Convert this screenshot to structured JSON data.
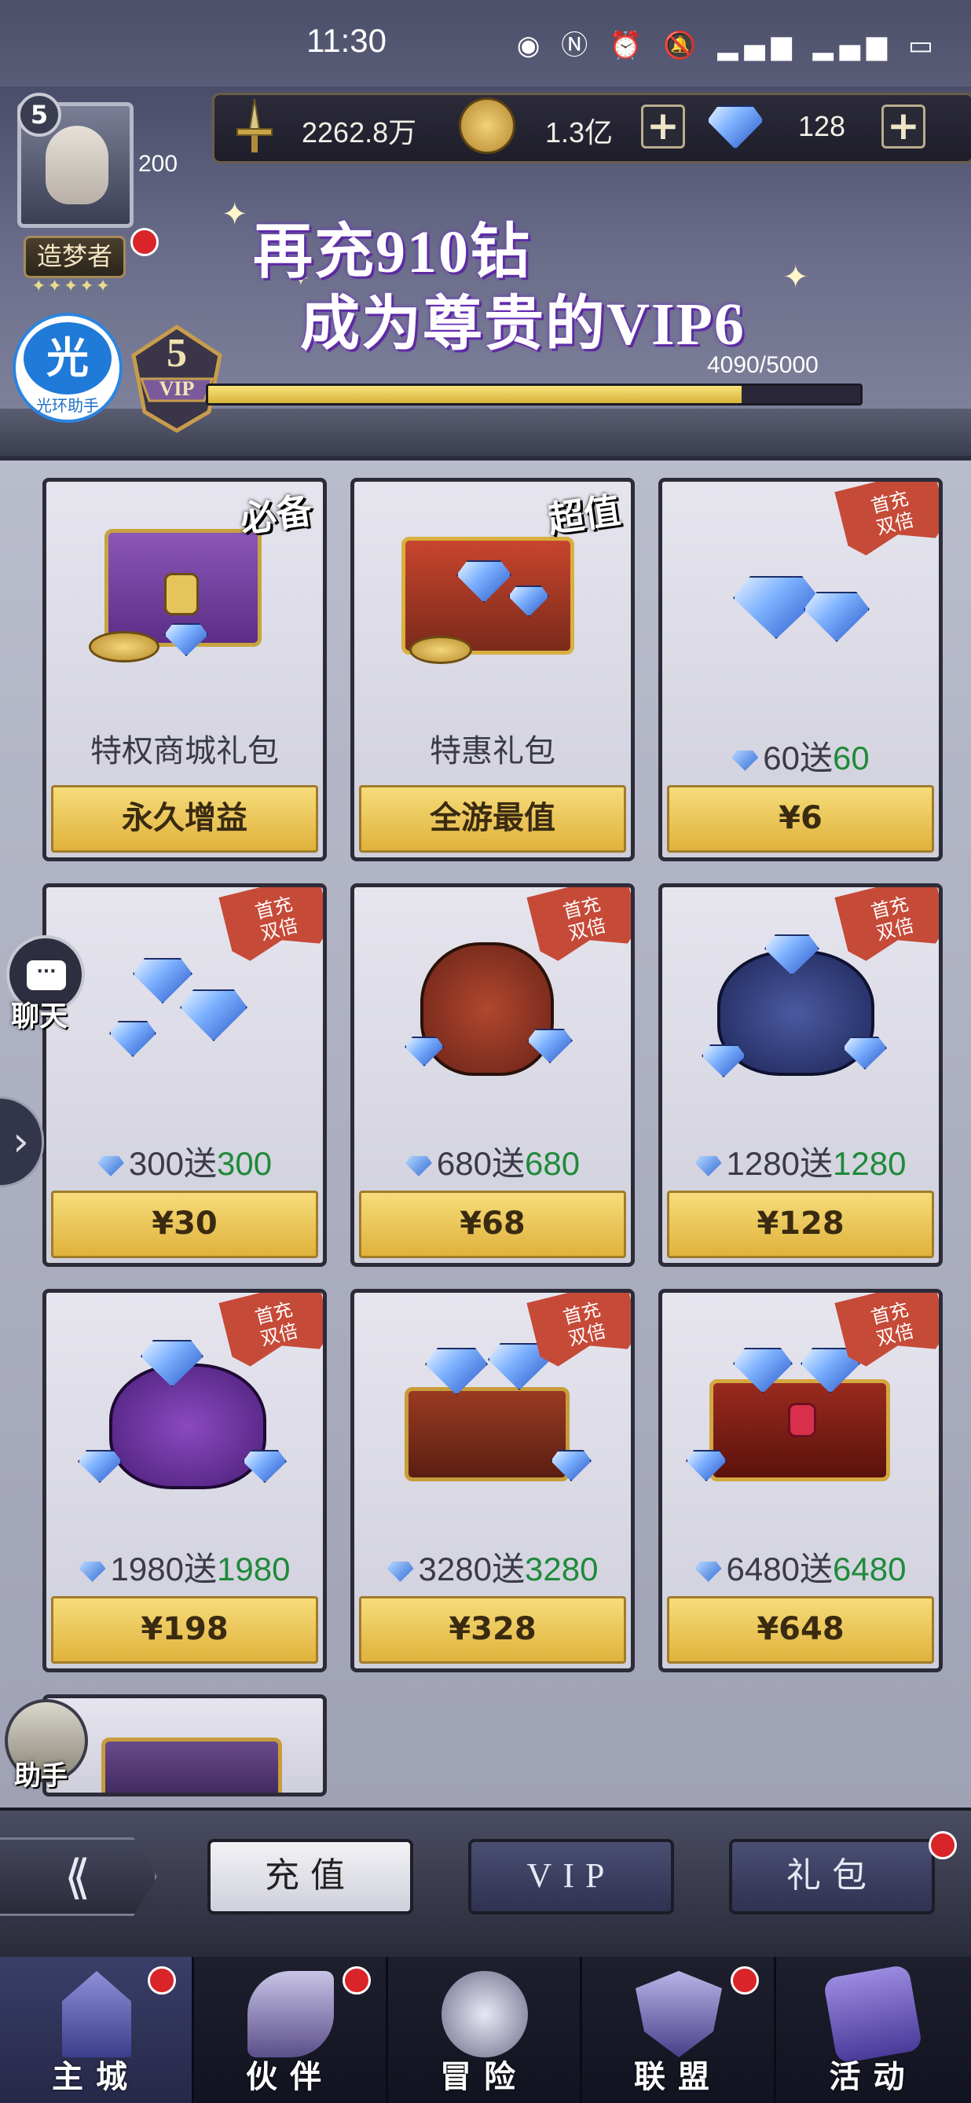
{
  "status_bar": {
    "time": "11:30",
    "icons": [
      "eye-icon",
      "nfc-icon",
      "alarm-icon",
      "mute-icon",
      "signal-4g-icon",
      "signal-4g-icon",
      "battery-icon"
    ],
    "icons_text": "◉ Ⓝ ⏰ 🔕 ▂▄▆ ▂▄▆ ▭"
  },
  "player": {
    "level": "5",
    "power_small": "200",
    "title": "造梦者",
    "stars": "✦✦✦✦✦"
  },
  "resources": {
    "power": "2262.8万",
    "gold": "1.3亿",
    "diamonds": "128"
  },
  "helper": {
    "glyph": "光",
    "label": "光环助手"
  },
  "vip": {
    "level": "5",
    "label": "VIP",
    "progress_text": "4090/5000",
    "progress_fraction": 0.818
  },
  "banner": {
    "line1": "再充910钻",
    "line2": "成为尊贵的VIP6"
  },
  "ribbon": {
    "line1": "首充",
    "line2": "双倍"
  },
  "cards": [
    {
      "name": "特权商城礼包",
      "button": "永久增益",
      "tag": "必备"
    },
    {
      "name": "特惠礼包",
      "button": "全游最值",
      "tag": "超值"
    },
    {
      "base": "60",
      "sep": "送",
      "bonus": "60",
      "button": "¥6"
    },
    {
      "base": "300",
      "sep": "送",
      "bonus": "300",
      "button": "¥30"
    },
    {
      "base": "680",
      "sep": "送",
      "bonus": "680",
      "button": "¥68"
    },
    {
      "base": "1280",
      "sep": "送",
      "bonus": "1280",
      "button": "¥128"
    },
    {
      "base": "1980",
      "sep": "送",
      "bonus": "1980",
      "button": "¥198"
    },
    {
      "base": "3280",
      "sep": "送",
      "bonus": "3280",
      "button": "¥328"
    },
    {
      "base": "6480",
      "sep": "送",
      "bonus": "6480",
      "button": "¥648"
    }
  ],
  "side": {
    "chat": "聊天",
    "assist": "助手",
    "chat_icon": "···",
    "arrow": "›"
  },
  "tabs": {
    "back": "⟪",
    "recharge": "充值",
    "vip": "VIP",
    "gift": "礼包"
  },
  "nav": [
    {
      "label": "主城",
      "icon": "castle-icon"
    },
    {
      "label": "伙伴",
      "icon": "partner-icon"
    },
    {
      "label": "冒险",
      "icon": "compass-icon"
    },
    {
      "label": "联盟",
      "icon": "shield-icon"
    },
    {
      "label": "活动",
      "icon": "cards-icon"
    }
  ],
  "colors": {
    "gold": "#e0b23c",
    "bonus_green": "#1f8a3a",
    "ribbon_red": "#c64a38",
    "vip_bar": "#d8b33a"
  }
}
